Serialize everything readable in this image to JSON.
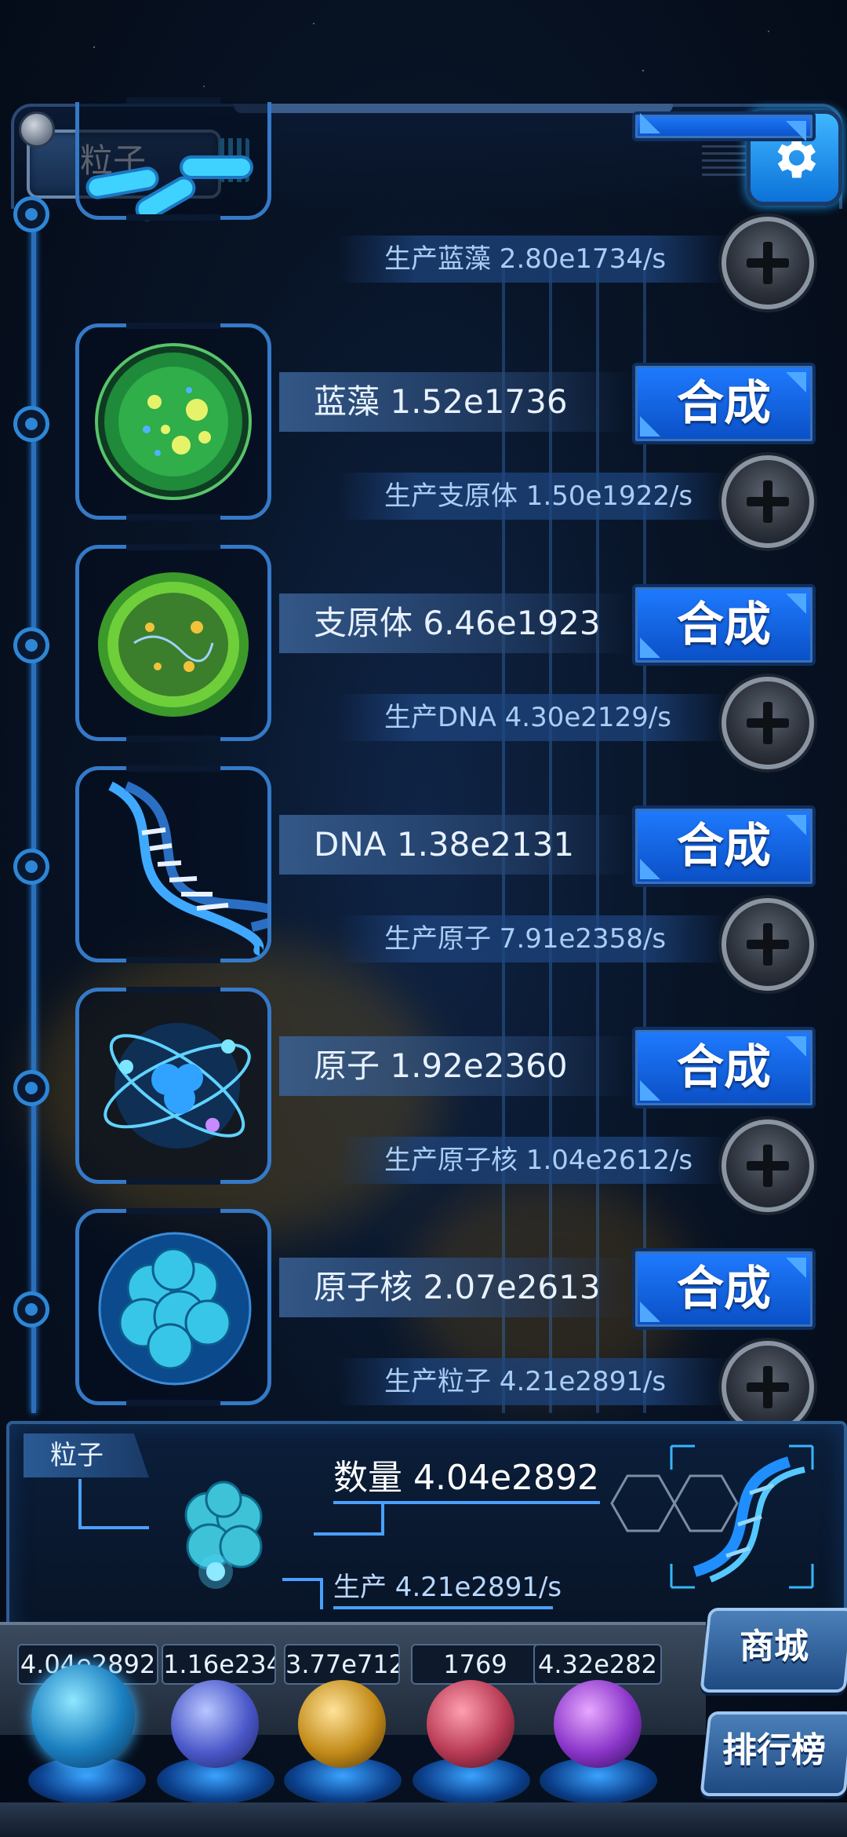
{
  "header": {
    "title": "粒子"
  },
  "rows": [
    {
      "name": "",
      "production": "生产蓝藻 2.80e1734/s",
      "synth_label": "",
      "icon": "bacteria-icon"
    },
    {
      "name": "蓝藻 1.52e1736",
      "production": "生产支原体 1.50e1922/s",
      "synth_label": "合成",
      "icon": "cyanobacteria-icon"
    },
    {
      "name": "支原体 6.46e1923",
      "production": "生产DNA 4.30e2129/s",
      "synth_label": "合成",
      "icon": "mycoplasma-icon"
    },
    {
      "name": "DNA 1.38e2131",
      "production": "生产原子 7.91e2358/s",
      "synth_label": "合成",
      "icon": "dna-icon"
    },
    {
      "name": "原子 1.92e2360",
      "production": "生产原子核 1.04e2612/s",
      "synth_label": "合成",
      "icon": "atom-icon"
    },
    {
      "name": "原子核 2.07e2613",
      "production": "生产粒子 4.21e2891/s",
      "synth_label": "合成",
      "icon": "nucleus-icon"
    }
  ],
  "panel": {
    "tag": "粒子",
    "count": "数量 4.04e2892",
    "production": "生产 4.21e2891/s"
  },
  "currencies": [
    {
      "value": "4.04e2892",
      "icon": "particle-orb-icon"
    },
    {
      "value": "1.16e234",
      "icon": "lightning-orb-icon"
    },
    {
      "value": "3.77e712",
      "icon": "galaxy-orb-icon"
    },
    {
      "value": "1769",
      "icon": "brain-orb-icon"
    },
    {
      "value": "4.32e282",
      "icon": "vortex-orb-icon"
    }
  ],
  "side_buttons": {
    "shop": "商城",
    "ranking": "排行榜"
  },
  "colors": {
    "accent": "#1f7bff",
    "rail": "#2a6fb8",
    "background": "#081426"
  }
}
